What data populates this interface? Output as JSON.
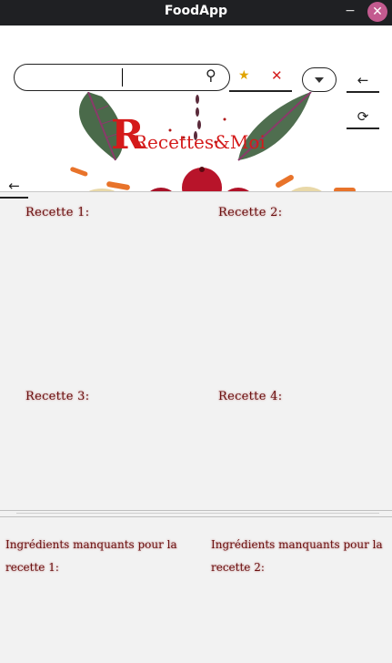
{
  "window": {
    "title": "FoodApp",
    "minimize": "−",
    "close": "✕"
  },
  "search": {
    "value": "",
    "placeholder": ""
  },
  "filters": {
    "favorite_icon": "★",
    "clear_icon": "✕"
  },
  "nav": {
    "back_icon": "←",
    "refresh_icon": "⟳",
    "left_back_icon": "←"
  },
  "banner": {
    "logo_text": "Recettes&Moi"
  },
  "recipes": [
    {
      "label": "Recette 1:"
    },
    {
      "label": "Recette 2:"
    },
    {
      "label": "Recette 3:"
    },
    {
      "label": "Recette 4:"
    }
  ],
  "missing": [
    {
      "label": "Ingrédients manquants pour la recette 1:"
    },
    {
      "label": "Ingrédients manquants pour la recette 2:"
    }
  ],
  "colors": {
    "accent": "#c00000",
    "titlebar": "#1f2023",
    "close": "#c35a8f",
    "star": "#e0a400"
  }
}
